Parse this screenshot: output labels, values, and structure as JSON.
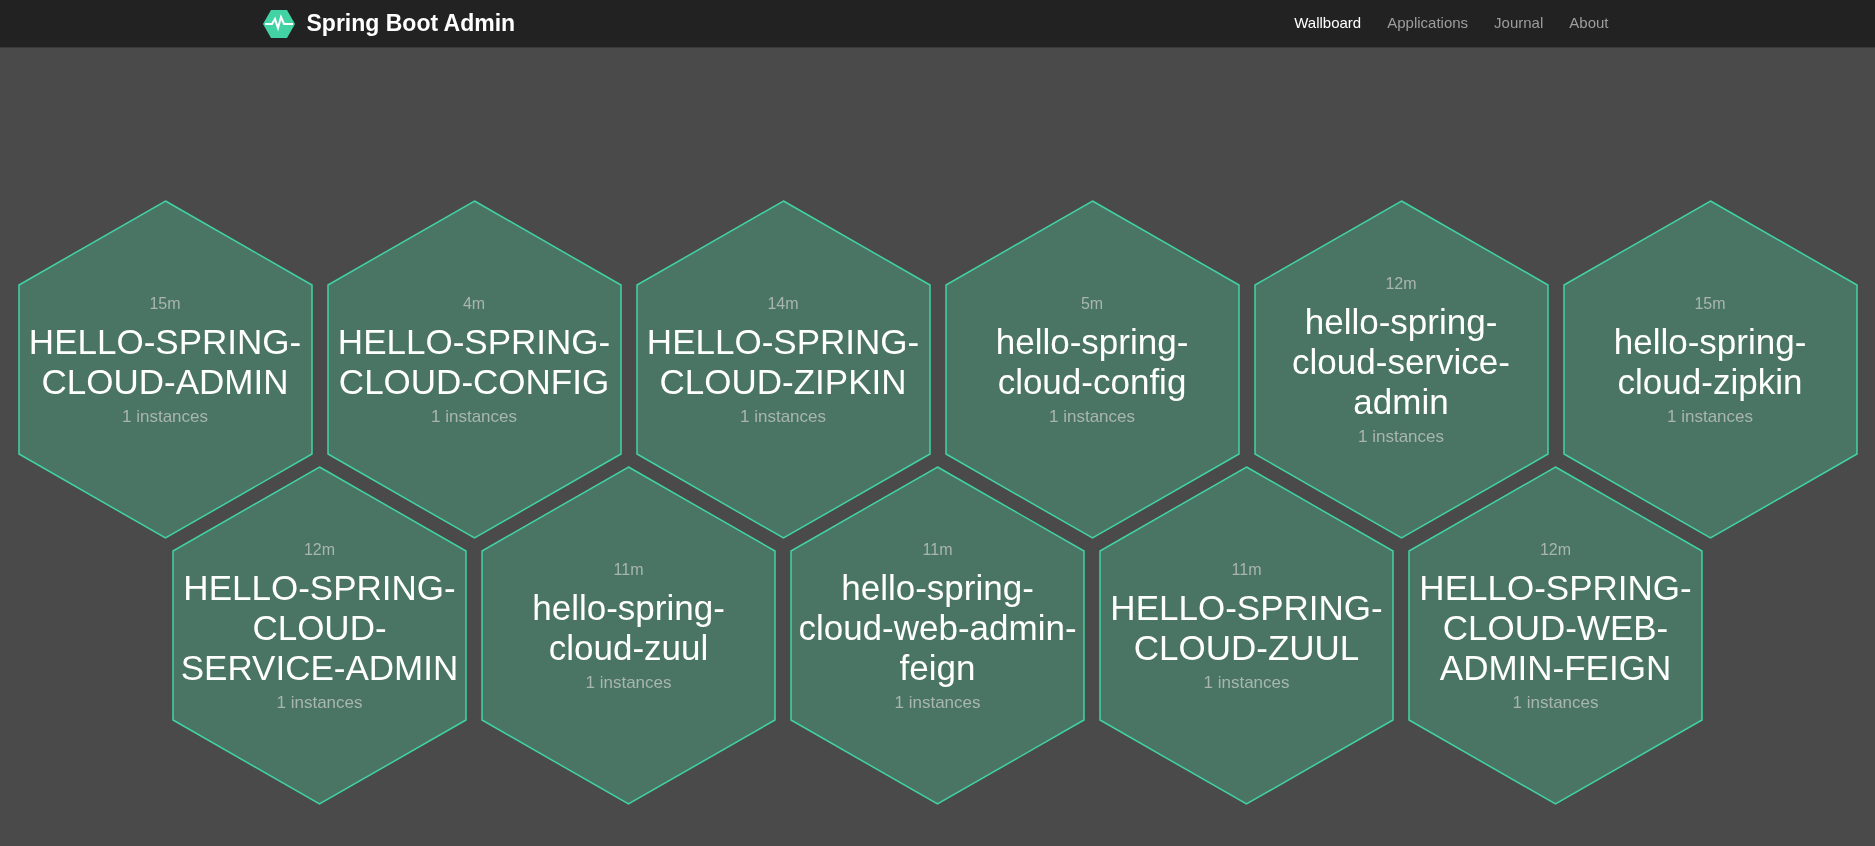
{
  "brand": {
    "title": "Spring Boot Admin"
  },
  "nav": [
    {
      "label": "Wallboard",
      "selected": true
    },
    {
      "label": "Applications",
      "selected": false
    },
    {
      "label": "Journal",
      "selected": false
    },
    {
      "label": "About",
      "selected": false
    }
  ],
  "tile_rows": [
    [
      {
        "uptime": "15m",
        "name": "HELLO-SPRING-CLOUD-ADMIN",
        "instances": "1 instances"
      },
      {
        "uptime": "4m",
        "name": "HELLO-SPRING-CLOUD-CONFIG",
        "instances": "1 instances"
      },
      {
        "uptime": "14m",
        "name": "HELLO-SPRING-CLOUD-ZIPKIN",
        "instances": "1 instances"
      },
      {
        "uptime": "5m",
        "name": "hello-spring-cloud-config",
        "instances": "1 instances"
      },
      {
        "uptime": "12m",
        "name": "hello-spring-cloud-service-admin",
        "instances": "1 instances"
      },
      {
        "uptime": "15m",
        "name": "hello-spring-cloud-zipkin",
        "instances": "1 instances"
      }
    ],
    [
      {
        "uptime": "12m",
        "name": "HELLO-SPRING-CLOUD-SERVICE-ADMIN",
        "instances": "1 instances"
      },
      {
        "uptime": "11m",
        "name": "hello-spring-cloud-zuul",
        "instances": "1 instances"
      },
      {
        "uptime": "11m",
        "name": "hello-spring-cloud-web-admin-feign",
        "instances": "1 instances"
      },
      {
        "uptime": "11m",
        "name": "HELLO-SPRING-CLOUD-ZUUL",
        "instances": "1 instances"
      },
      {
        "uptime": "12m",
        "name": "HELLO-SPRING-CLOUD-WEB-ADMIN-FEIGN",
        "instances": "1 instances"
      }
    ]
  ]
}
